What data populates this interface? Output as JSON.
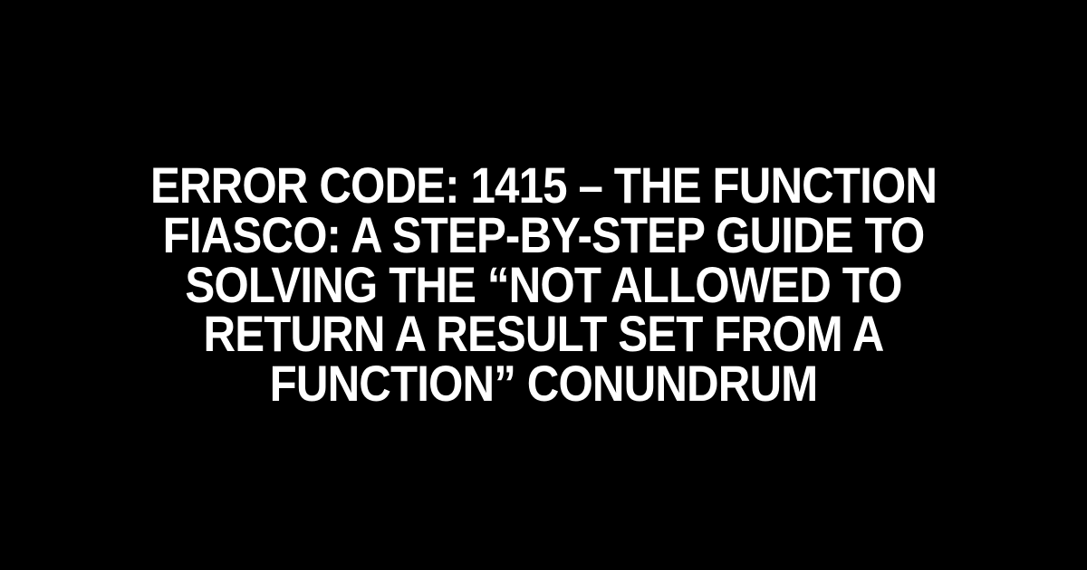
{
  "headline": "Error Code: 1415 – The Function Fiasco: A Step-by-Step Guide to Solving the “Not Allowed to Return a Result Set from a Function” Conundrum"
}
